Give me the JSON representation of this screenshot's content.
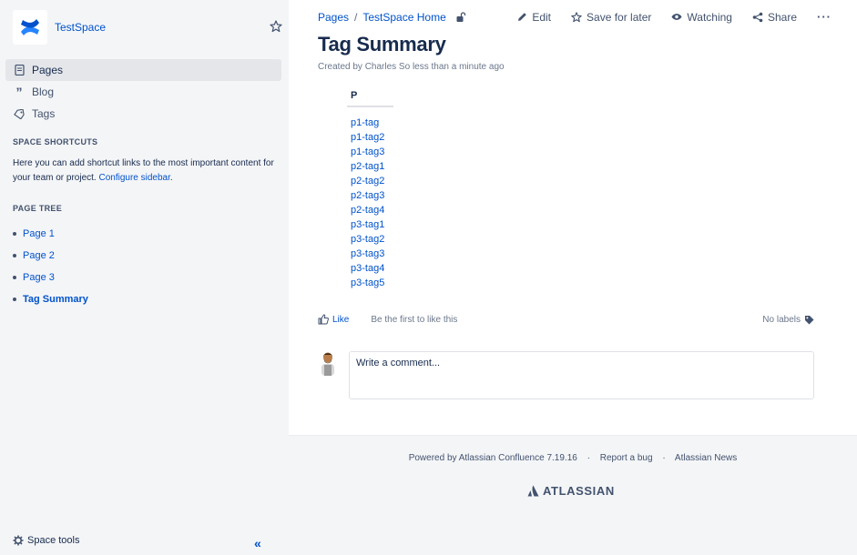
{
  "sidebar": {
    "space_name": "TestSpace",
    "nav": [
      {
        "label": "Pages",
        "icon": "pages-icon",
        "active": true
      },
      {
        "label": "Blog",
        "icon": "blog-quote-icon",
        "active": false
      },
      {
        "label": "Tags",
        "icon": "tags-icon",
        "active": false
      }
    ],
    "shortcuts_title": "SPACE SHORTCUTS",
    "shortcuts_text": "Here you can add shortcut links to the most important content for your team or project.",
    "shortcuts_link": "Configure sidebar",
    "shortcuts_end": ".",
    "tree_title": "PAGE TREE",
    "tree": [
      "Page 1",
      "Page 2",
      "Page 3",
      "Tag Summary"
    ],
    "space_tools": "Space tools"
  },
  "breadcrumb": [
    "Pages",
    "TestSpace Home"
  ],
  "breadcrumb_sep": "/",
  "actions": {
    "edit": "Edit",
    "save": "Save for later",
    "watching": "Watching",
    "share": "Share",
    "more": "···"
  },
  "page": {
    "title": "Tag Summary",
    "byline": "Created by Charles So less than a minute ago",
    "column_header": "P",
    "tags": [
      "p1-tag",
      "p1-tag2",
      "p1-tag3",
      "p2-tag1",
      "p2-tag2",
      "p2-tag3",
      "p2-tag4",
      "p3-tag1",
      "p3-tag2",
      "p3-tag3",
      "p3-tag4",
      "p3-tag5"
    ]
  },
  "like": {
    "label": "Like",
    "text": "Be the first to like this",
    "labels": "No labels"
  },
  "comment": {
    "placeholder": "Write a comment..."
  },
  "footer": {
    "powered": "Powered by Atlassian Confluence 7.19.16",
    "bug": "Report a bug",
    "news": "Atlassian News",
    "dot": "·",
    "logo_text": "ATLASSIAN"
  },
  "colors": {
    "link": "#0052cc",
    "sidebar_bg": "#f4f5f7",
    "text": "#172b4d"
  }
}
